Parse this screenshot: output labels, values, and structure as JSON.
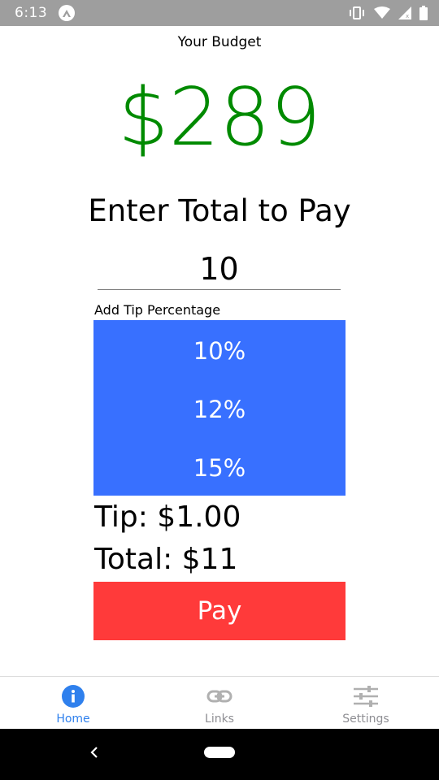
{
  "status_bar": {
    "time": "6:13"
  },
  "budget": {
    "label": "Your Budget",
    "amount": "$289",
    "amount_color": "#008a00"
  },
  "entry": {
    "title": "Enter Total to Pay",
    "value": "10"
  },
  "tip": {
    "label": "Add Tip Percentage",
    "options": [
      "10%",
      "12%",
      "15%"
    ],
    "picker_color": "#3870ff"
  },
  "summary": {
    "tip_text": "Tip: $1.00",
    "total_text": "Total: $11"
  },
  "pay_button": {
    "label": "Pay",
    "color": "#ff3a3a"
  },
  "tabs": [
    {
      "label": "Home",
      "icon": "info-icon",
      "active": true
    },
    {
      "label": "Links",
      "icon": "link-icon",
      "active": false
    },
    {
      "label": "Settings",
      "icon": "sliders-icon",
      "active": false
    }
  ],
  "colors": {
    "active_tab": "#2f80ed",
    "inactive_tab": "#8e8e93",
    "status_bar": "#9e9e9e"
  }
}
